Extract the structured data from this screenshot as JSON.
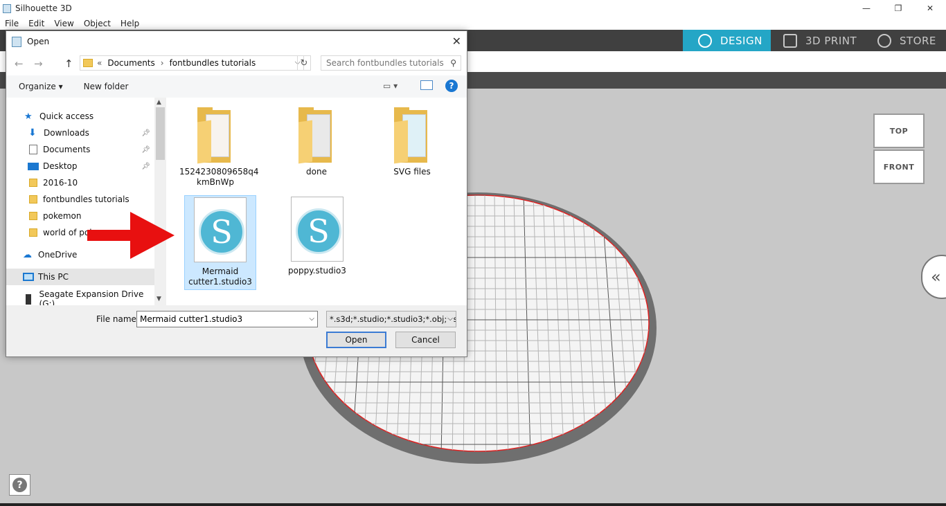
{
  "app": {
    "title": "Silhouette 3D",
    "menu": [
      "File",
      "Edit",
      "View",
      "Object",
      "Help"
    ],
    "window_controls": [
      "—",
      "❐",
      "✕"
    ]
  },
  "tabs": [
    {
      "label": "DESIGN",
      "icon": "globe-icon",
      "active": true
    },
    {
      "label": "3D PRINT",
      "icon": "cube-icon",
      "active": false
    },
    {
      "label": "STORE",
      "icon": "silhouette-s-icon",
      "active": false
    }
  ],
  "viewcube": {
    "top": "TOP",
    "front": "FRONT"
  },
  "colors": {
    "accent": "#24a6c6",
    "tabbar": "#404040",
    "arrow": "#e81010",
    "mat_edge": "#e02020"
  },
  "dialog": {
    "title": "Open",
    "breadcrumb": {
      "prefix": "«",
      "path": [
        "Documents",
        "fontbundles tutorials"
      ]
    },
    "search_placeholder": "Search fontbundles tutorials",
    "organize": "Organize ▾",
    "new_folder": "New folder",
    "nav": [
      {
        "label": "Quick access",
        "icon": "star-icon"
      },
      {
        "label": "Downloads",
        "icon": "download-icon",
        "pinned": true
      },
      {
        "label": "Documents",
        "icon": "document-icon",
        "pinned": true
      },
      {
        "label": "Desktop",
        "icon": "desktop-icon",
        "pinned": true
      },
      {
        "label": "2016-10",
        "icon": "folder-icon"
      },
      {
        "label": "fontbundles tutorials",
        "icon": "folder-icon"
      },
      {
        "label": "pokemon",
        "icon": "folder-icon"
      },
      {
        "label": "world of pok",
        "icon": "folder-icon"
      },
      {
        "label": "OneDrive",
        "icon": "cloud-icon"
      },
      {
        "label": "This PC",
        "icon": "computer-icon",
        "selected": true
      },
      {
        "label": "Seagate Expansion Drive (G:)",
        "icon": "drive-icon"
      }
    ],
    "files": [
      {
        "name": "1524230809658q4 kmBnWp",
        "type": "folder"
      },
      {
        "name": "done",
        "type": "folder"
      },
      {
        "name": "SVG files",
        "type": "folder"
      },
      {
        "name": "Mermaid cutter1.studio3",
        "type": "studio3",
        "selected": true
      },
      {
        "name": "poppy.studio3",
        "type": "studio3"
      }
    ],
    "file_name_label": "File name:",
    "file_name_value": "Mermaid cutter1.studio3",
    "file_type_value": "*.s3d;*.studio;*.studio3;*.obj;*.s",
    "open_label": "Open",
    "cancel_label": "Cancel"
  }
}
